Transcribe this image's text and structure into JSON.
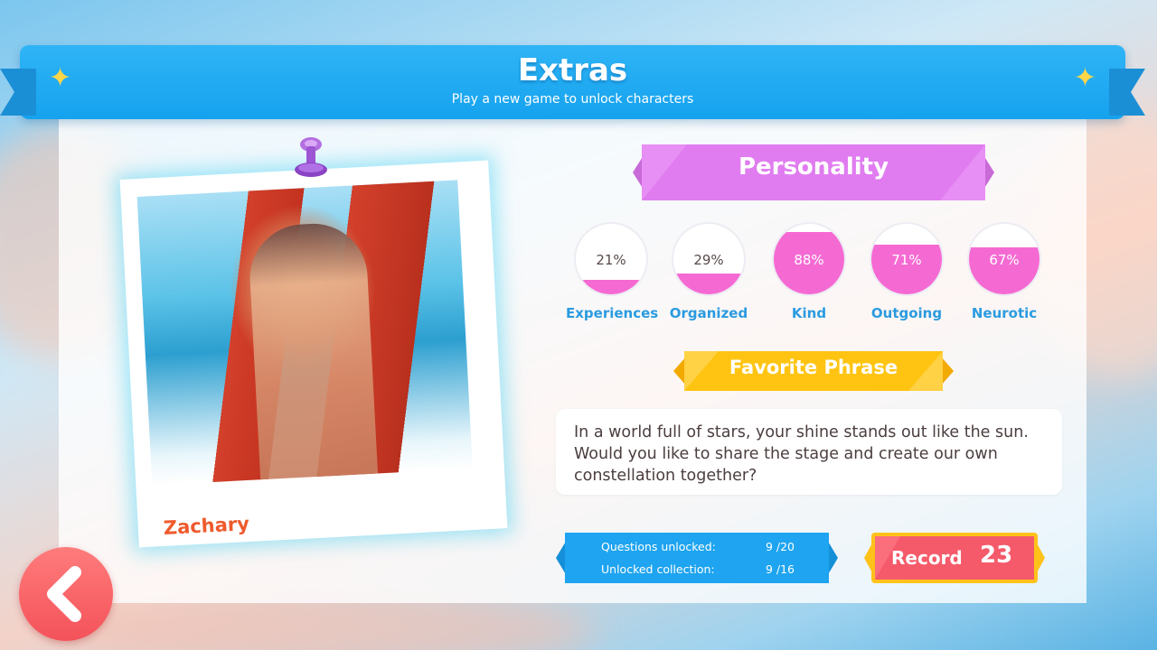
{
  "header": {
    "title": "Extras",
    "subtitle": "Play a new game to unlock characters"
  },
  "character": {
    "name": "Zachary"
  },
  "personality": {
    "title": "Personality",
    "traits": [
      {
        "label": "Experiences",
        "value_text": "21%",
        "value": 21
      },
      {
        "label": "Organized",
        "value_text": "29%",
        "value": 29
      },
      {
        "label": "Kind",
        "value_text": "88%",
        "value": 88
      },
      {
        "label": "Outgoing",
        "value_text": "71%",
        "value": 71
      },
      {
        "label": "Neurotic",
        "value_text": "67%",
        "value": 67
      }
    ]
  },
  "favorite_phrase": {
    "title": "Favorite Phrase",
    "text": "In a world full of stars, your shine stands out like the sun. Would you like to share the stage and create our own constellation together?"
  },
  "counts": {
    "questions_label": "Questions unlocked:",
    "questions_value": "9 /20",
    "collection_label": "Unlocked collection:",
    "collection_value": "9 /16"
  },
  "record": {
    "label": "Record",
    "value": "23"
  },
  "icons": {
    "back": "chevron-left-icon",
    "sparkle": "sparkle-icon",
    "pin": "pushpin-icon"
  },
  "colors": {
    "header_blue": "#15a2ee",
    "personality_pink": "#e778ef",
    "trait_fill": "#f56ad2",
    "phrase_yellow": "#ffc20e",
    "counts_blue": "#1ea4f0",
    "record_red": "#f55a6a",
    "name_orange": "#ef5a2c"
  }
}
